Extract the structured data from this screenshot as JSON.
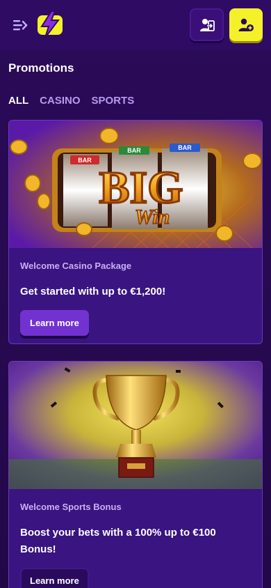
{
  "header": {
    "menu_icon": "menu-collapse-icon",
    "logo_icon": "lightning-bolt-logo",
    "login_icon": "user-login-icon",
    "register_icon": "user-add-icon",
    "accent": "#f4f12a"
  },
  "page_title": "Promotions",
  "tabs": [
    {
      "label": "ALL",
      "active": true
    },
    {
      "label": "CASINO",
      "active": false
    },
    {
      "label": "SPORTS",
      "active": false
    }
  ],
  "promotions": [
    {
      "image": "big-win-slot-image",
      "subtitle": "Welcome Casino Package",
      "headline": "Get started with up to €1,200!",
      "button_label": "Learn more",
      "art": {
        "reel_label": "BAR",
        "word1": "BIG",
        "word2": "Win"
      }
    },
    {
      "image": "trophy-image",
      "subtitle": "Welcome Sports Bonus",
      "headline": "Boost your bets with a 100% up to €100 Bonus!",
      "button_label": "Learn more"
    }
  ]
}
